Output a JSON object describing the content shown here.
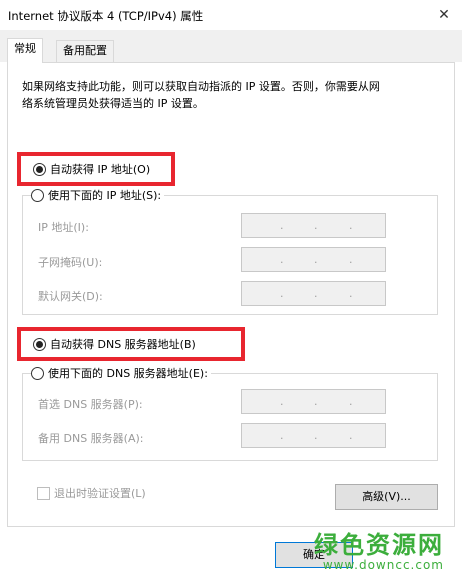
{
  "window": {
    "title": "Internet 协议版本 4 (TCP/IPv4) 属性",
    "close_icon": "close-icon"
  },
  "tabs": [
    {
      "label": "常规",
      "active": true
    },
    {
      "label": "备用配置",
      "active": false
    }
  ],
  "description_line1": "如果网络支持此功能，则可以获取自动指派的 IP 设置。否则，你需要从网",
  "description_line2": "络系统管理员处获得适当的 IP 设置。",
  "ip": {
    "auto_label": "自动获得 IP 地址(O)",
    "auto_checked": true,
    "manual_label": "使用下面的 IP 地址(S):",
    "manual_checked": false,
    "fields": [
      {
        "label": "IP 地址(I):",
        "value": ". . ."
      },
      {
        "label": "子网掩码(U):",
        "value": ". . ."
      },
      {
        "label": "默认网关(D):",
        "value": ". . ."
      }
    ]
  },
  "dns": {
    "auto_label": "自动获得 DNS 服务器地址(B)",
    "auto_checked": true,
    "manual_label": "使用下面的 DNS 服务器地址(E):",
    "manual_checked": false,
    "fields": [
      {
        "label": "首选 DNS 服务器(P):",
        "value": ". . ."
      },
      {
        "label": "备用 DNS 服务器(A):",
        "value": ". . ."
      }
    ]
  },
  "validate_on_exit": {
    "label": "退出时验证设置(L)",
    "checked": false
  },
  "buttons": {
    "advanced": "高级(V)...",
    "ok": "确定"
  },
  "watermark": {
    "brand": "绿色资源网",
    "url": "www.downcc.com"
  },
  "colors": {
    "highlight": "#e8262f",
    "watermark": "#3cae3c"
  }
}
